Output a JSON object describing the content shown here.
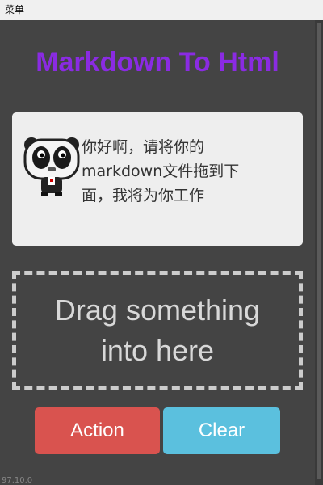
{
  "menubar": {
    "menu_label": "菜单"
  },
  "header": {
    "title": "Markdown To Html"
  },
  "message_card": {
    "avatar_icon": "panda-icon",
    "text": "你好啊，请将你的markdown文件拖到下面，我将为你工作"
  },
  "dropzone": {
    "text": "Drag something into here"
  },
  "actions": {
    "action_label": "Action",
    "clear_label": "Clear"
  },
  "footer": {
    "version": "97.10.0"
  },
  "colors": {
    "background": "#444444",
    "title": "#8a2be2",
    "action": "#d9534f",
    "clear": "#5bc0de",
    "card": "#eeeeee"
  }
}
